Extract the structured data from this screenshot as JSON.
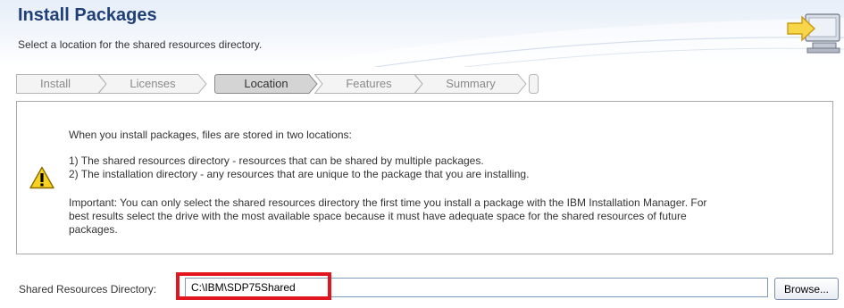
{
  "header": {
    "title": "Install Packages",
    "subtitle": "Select a location for the shared resources directory.",
    "icon": "computer-arrow-icon"
  },
  "wizard": {
    "steps": [
      {
        "label": "Install",
        "active": false
      },
      {
        "label": "Licenses",
        "active": false
      },
      {
        "label": "Location",
        "active": true
      },
      {
        "label": "Features",
        "active": false
      },
      {
        "label": "Summary",
        "active": false
      }
    ]
  },
  "info": {
    "icon": "warning-icon",
    "intro": "When you install packages, files are stored in two locations:",
    "item1": "1) The shared resources directory - resources that can be shared by multiple packages.",
    "item2": "2) The installation directory - any resources that are unique to the package that you are installing.",
    "important_line1": "Important: You can only select the shared resources directory the first time you install a package with the IBM Installation Manager. For",
    "important_line2": "best results select the drive with the most available space because it must have adequate space for the shared resources of future",
    "important_line3": "packages."
  },
  "form": {
    "label": "Shared Resources Directory:",
    "value": "C:\\IBM\\SDP75Shared",
    "browse_label": "Browse...",
    "highlight_color": "#e2161f"
  },
  "colors": {
    "title": "#1f3f76",
    "accent": "#f5c400"
  }
}
